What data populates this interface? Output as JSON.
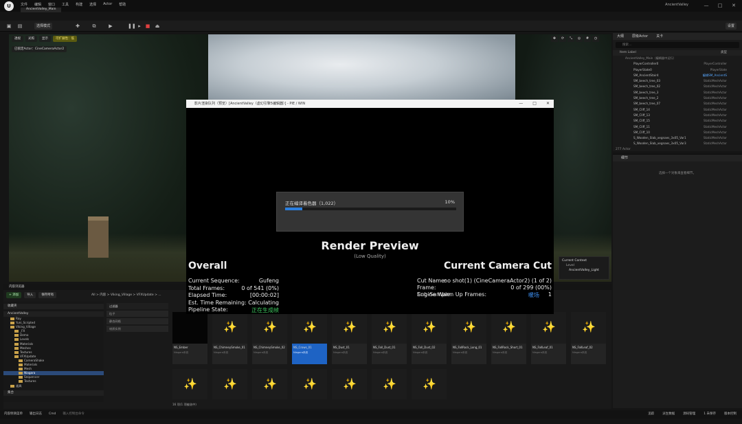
{
  "titlebar": {
    "logo": "U",
    "menu": [
      "文件",
      "编辑",
      "窗口",
      "工具",
      "构建",
      "选择",
      "Actor",
      "帮助"
    ],
    "tab": "AncientValley_Main",
    "project": "AncientValley",
    "min": "—",
    "max": "□",
    "close": "✕"
  },
  "toolbar": {
    "mode_label": "选择模式",
    "settings_label": "设置"
  },
  "viewport": {
    "chips": [
      "透视",
      "光照",
      "显示",
      "可扩展性：低"
    ],
    "camera_chip": "已锁定Actor：CineCameraActor2"
  },
  "outliner": {
    "tabs": [
      "大纲",
      "层级Actor",
      "关卡"
    ],
    "search_placeholder": "搜索...",
    "col_label": "Item Label",
    "col_type": "类型",
    "root": "AncientValley_Main（编辑器中运行）",
    "rows": [
      {
        "label": "PlayerController0",
        "type": "PlayerController",
        "sel": false
      },
      {
        "label": "PlayerState0",
        "type": "PlayerState",
        "sel": false
      },
      {
        "label": "SM_AncientStair4",
        "type": "编辑SM_AncientS",
        "sel": true
      },
      {
        "label": "SM_beech_tree_03",
        "type": "StaticMeshActor",
        "sel": false
      },
      {
        "label": "SM_beech_tree_02",
        "type": "StaticMeshActor",
        "sel": false
      },
      {
        "label": "SM_beech_tree_3",
        "type": "StaticMeshActor",
        "sel": false
      },
      {
        "label": "SM_beech_tree_2",
        "type": "StaticMeshActor",
        "sel": false
      },
      {
        "label": "SM_beech_tree_07",
        "type": "StaticMeshActor",
        "sel": false
      },
      {
        "label": "SM_Cliff_14",
        "type": "StaticMeshActor",
        "sel": false
      },
      {
        "label": "SM_Cliff_13",
        "type": "StaticMeshActor",
        "sel": false
      },
      {
        "label": "SM_Cliff_15",
        "type": "StaticMeshActor",
        "sel": false
      },
      {
        "label": "SM_Cliff_11",
        "type": "StaticMeshActor",
        "sel": false
      },
      {
        "label": "SM_Cliff_10",
        "type": "StaticMeshActor",
        "sel": false
      },
      {
        "label": "S_Wooden_Slab_xegnaes_3x05_Var1",
        "type": "StaticMeshActor",
        "sel": false
      },
      {
        "label": "S_Wooden_Slab_xegnaes_3x05_Var3",
        "type": "StaticMeshActor",
        "sel": false
      }
    ],
    "count": "277 Actor"
  },
  "details": {
    "tab": "细节",
    "empty": "选择一个对象来查看细节。"
  },
  "dialog": {
    "title": "影片渲染队列（预览）[AncientValley（虚幻引擎5编辑器）] - PIE / WIN",
    "progress_label": "正在编译着色器（1,022）",
    "progress_pct": "10%",
    "progress_value": 0.1,
    "render_preview": "Render Preview",
    "quality": "(Low Quality)",
    "overall": "Overall",
    "current_camera_cut": "Current Camera Cut",
    "left_rows": [
      {
        "k": "Current Sequence:",
        "v": "Gufeng"
      },
      {
        "k": "Total Frames:",
        "v": "0 of 541 (0%)"
      },
      {
        "k": "Elapsed Time:",
        "v": "[00:00:02]"
      },
      {
        "k": "Est. Time Remaining:",
        "v": "Calculating"
      },
      {
        "k": "Pipeline State:",
        "v": "正在生成帧"
      }
    ],
    "cut_name_label": "Cut Name:",
    "cut_name_value": "no shot(1) (CineCameraActor2) (1 of 2)",
    "frame_label": "Frame:",
    "frame_value": "0 of 299 (00%)",
    "warmup_label": "Engine Warm Up Frames:",
    "warmup_overlap": "Sub-Sample:",
    "warmup_value": "1",
    "warmup_status": "暖场"
  },
  "current_context": {
    "title": "Current Context",
    "level_label": "Level",
    "level_value": "AncientValley_Light"
  },
  "content_browser": {
    "tab": "内容浏览器",
    "add": "+ 添加",
    "import": "导入",
    "save_all": "保存所有",
    "crumb": "All  >  内容  >  Viking_Village  >  VFXUpdate  >  ...",
    "favorites": "收藏夹",
    "project": "AncientValley",
    "folders": [
      {
        "name": "Ray",
        "depth": 1,
        "sel": false
      },
      {
        "name": "Yuni_Scripted",
        "depth": 1,
        "sel": false
      },
      {
        "name": "Viking_Village",
        "depth": 1,
        "sel": false
      },
      {
        "name": "_FX",
        "depth": 2,
        "sel": false
      },
      {
        "name": "Demo",
        "depth": 2,
        "sel": false
      },
      {
        "name": "Levels",
        "depth": 2,
        "sel": false
      },
      {
        "name": "Materials",
        "depth": 2,
        "sel": false
      },
      {
        "name": "Meshes",
        "depth": 2,
        "sel": false
      },
      {
        "name": "Textures",
        "depth": 2,
        "sel": false
      },
      {
        "name": "VFXUpdate",
        "depth": 2,
        "sel": false
      },
      {
        "name": "CameraShake",
        "depth": 3,
        "sel": false
      },
      {
        "name": "Materials",
        "depth": 3,
        "sel": false
      },
      {
        "name": "Mesh",
        "depth": 3,
        "sel": false
      },
      {
        "name": "Niagara",
        "depth": 3,
        "sel": true
      },
      {
        "name": "Sequencer",
        "depth": 3,
        "sel": false
      },
      {
        "name": "Textures",
        "depth": 3,
        "sel": false
      },
      {
        "name": "道具",
        "depth": 1,
        "sel": false
      }
    ],
    "collections": "集合",
    "filters_title": "过滤器",
    "filters": [
      "粒子",
      "静态网格",
      "材质实例"
    ],
    "tiles_row1": [
      {
        "name": "NS_Ember",
        "type": "Niagara系统",
        "dark": true,
        "sel": false
      },
      {
        "name": "NS_ChimneySmoke_01",
        "type": "Niagara系统",
        "dark": false,
        "sel": false
      },
      {
        "name": "NS_ChimneySmoke_02",
        "type": "Niagara系统",
        "dark": false,
        "sel": false
      },
      {
        "name": "NS_Crows_01",
        "type": "Niagara系统",
        "dark": false,
        "sel": true
      },
      {
        "name": "NS_Dust_01",
        "type": "Niagara系统",
        "dark": false,
        "sel": false
      },
      {
        "name": "NS_Fall_Dust_01",
        "type": "Niagara系统",
        "dark": false,
        "sel": false
      },
      {
        "name": "NS_Fall_Dust_02",
        "type": "Niagara系统",
        "dark": false,
        "sel": false
      },
      {
        "name": "NS_FallRock_Long_01",
        "type": "Niagara系统",
        "dark": false,
        "sel": false
      },
      {
        "name": "NS_FallRock_Short_01",
        "type": "Niagara系统",
        "dark": false,
        "sel": false
      },
      {
        "name": "NS_FallLeaf_01",
        "type": "Niagara系统",
        "dark": false,
        "sel": false
      },
      {
        "name": "NS_FallLeaf_02",
        "type": "Niagara系统",
        "dark": false,
        "sel": false
      }
    ],
    "row2_count": 7,
    "selected_info": "16 项(1 项被选中)"
  },
  "statusbar": {
    "left": [
      "内容侧滑菜单",
      "输出日志",
      "Cmd"
    ],
    "cmd_placeholder": "输入控制台命令",
    "right": [
      "追踪",
      "派生数据",
      "源码管理",
      "1 未保存",
      "版本控制"
    ]
  }
}
